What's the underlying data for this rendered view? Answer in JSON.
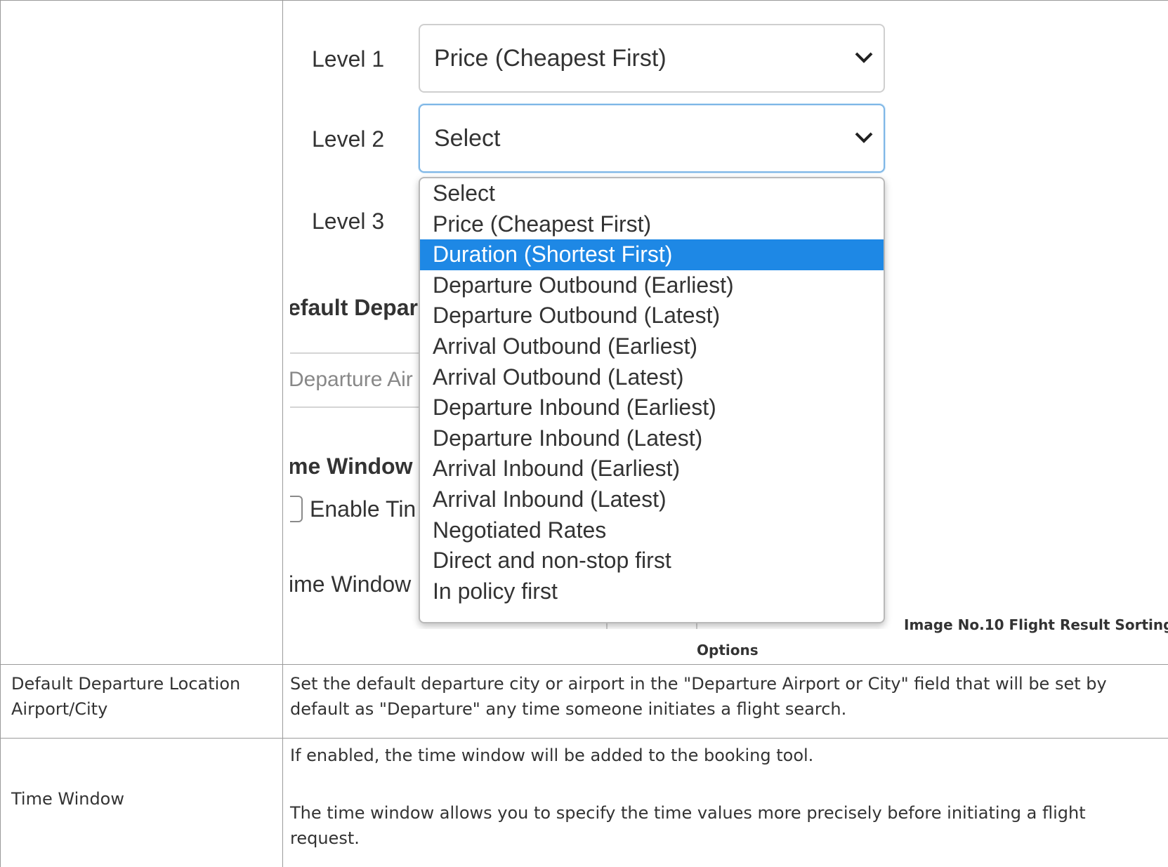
{
  "screenshot": {
    "level1": {
      "label": "Level 1",
      "value": "Price (Cheapest First)"
    },
    "level2": {
      "label": "Level 2",
      "value": "Select"
    },
    "level3": {
      "label": "Level 3"
    },
    "partial_texts": {
      "default_departure_heading": "efault Depar",
      "departure_airport_placeholder": "Departure Air",
      "time_window_heading": "me Window",
      "enable_time_window": "Enable Tin",
      "time_window_label": "ime Window"
    },
    "dropdown": {
      "selected_index": 2,
      "options": [
        "Select",
        "Price (Cheapest First)",
        "Duration (Shortest First)",
        "Departure Outbound (Earliest)",
        "Departure Outbound (Latest)",
        "Arrival Outbound (Earliest)",
        "Arrival Outbound (Latest)",
        "Departure Inbound (Earliest)",
        "Departure Inbound (Latest)",
        "Arrival Inbound (Earliest)",
        "Arrival Inbound (Latest)",
        "Negotiated Rates",
        "Direct and non-stop first",
        "In policy first"
      ]
    }
  },
  "caption": {
    "line1": "Image No.10 Flight Result Sorting",
    "line2": "Options"
  },
  "rows": [
    {
      "name": "Default Departure Location Airport/City",
      "description": "Set the default departure city or airport in the \"Departure Airport or City\" field that will be set by default as \"Departure\" any time someone initiates a flight search."
    },
    {
      "name": "Time Window",
      "description_p1": "If enabled, the time window will be added to the booking tool.",
      "description_p2": "The time window allows you to specify the time values more precisely before initiating a flight request."
    }
  ],
  "colors": {
    "highlight": "#1e88e5",
    "border": "#9a9a9a"
  }
}
